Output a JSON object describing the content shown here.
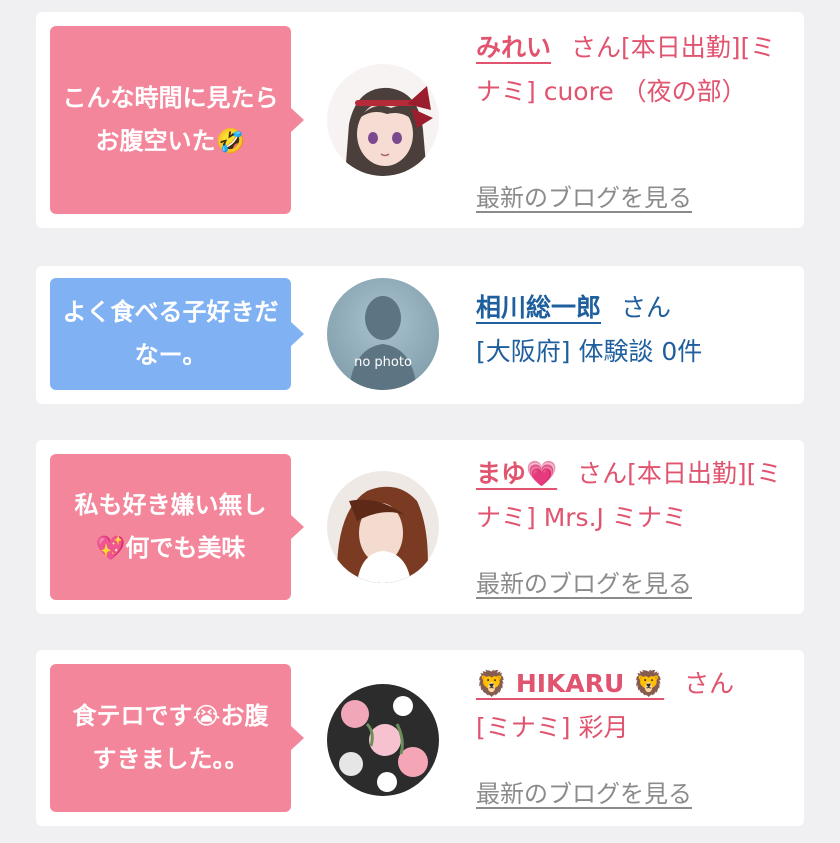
{
  "posts": [
    {
      "comment": "こんな時間に見たらお腹空いた🤣",
      "name": "みれい",
      "honorific": "さん",
      "details": "[本日出勤][ミナミ] cuore （夜の部）",
      "blog_link": "最新のブログを見る"
    },
    {
      "comment": "よく食べる子好きだなー。",
      "name": "相川総一郎",
      "honorific": "さん",
      "details": "[大阪府] 体験談 0件",
      "avatar_caption": "no photo"
    },
    {
      "comment": "私も好き嫌い無し💖何でも美味",
      "name": "まゆ💗",
      "honorific": "さん",
      "details": "[本日出勤][ミナミ] Mrs.J ミナミ",
      "blog_link": "最新のブログを見る"
    },
    {
      "comment": "食テロです😭お腹すきました。。",
      "name": "🦁 HIKARU 🦁",
      "honorific": "さん",
      "details": "[ミナミ] 彩月",
      "blog_link": "最新のブログを見る"
    }
  ],
  "colors": {
    "pink_bubble": "#f4869b",
    "blue_bubble": "#7fb1f3",
    "pink_text": "#e0546f",
    "blue_text": "#1f5f9e",
    "link_gray": "#8b8b8b"
  }
}
